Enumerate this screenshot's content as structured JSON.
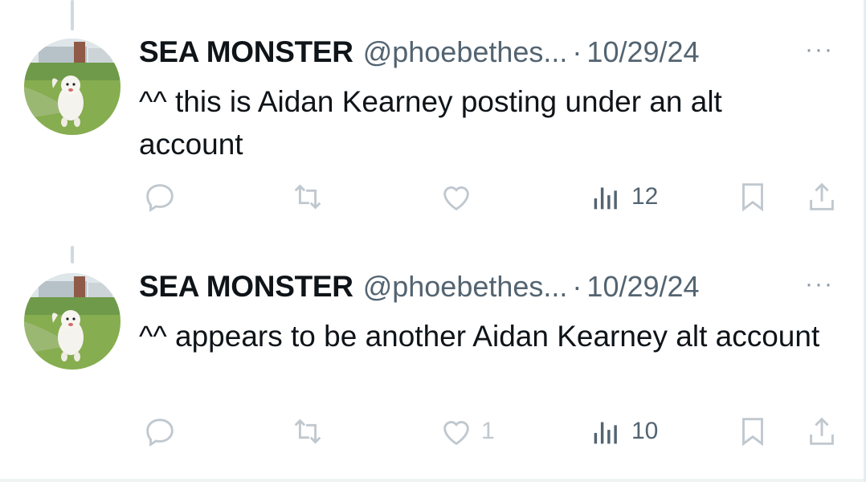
{
  "tweets": [
    {
      "display_name": "SEA MONSTER",
      "handle": "@phoebethes...",
      "separator": "·",
      "date": "10/29/24",
      "more": "···",
      "text": "^^ this is Aidan Kearney posting under an alt account",
      "stats": {
        "replies": "",
        "reposts": "",
        "likes": "",
        "views": "12"
      }
    },
    {
      "display_name": "SEA MONSTER",
      "handle": "@phoebethes...",
      "separator": "·",
      "date": "10/29/24",
      "more": "···",
      "text": "^^ appears to be another Aidan Kearney alt account",
      "stats": {
        "replies": "",
        "reposts": "",
        "likes": "1",
        "views": "10"
      }
    }
  ],
  "icons": [
    "reply-icon",
    "repost-icon",
    "like-icon",
    "views-icon",
    "bookmark-icon",
    "share-icon",
    "more-icon"
  ],
  "colors": {
    "text": "#0f1419",
    "secondary": "#536471",
    "icon_light": "#c0c8cf",
    "thread_line": "#cfd9de"
  }
}
